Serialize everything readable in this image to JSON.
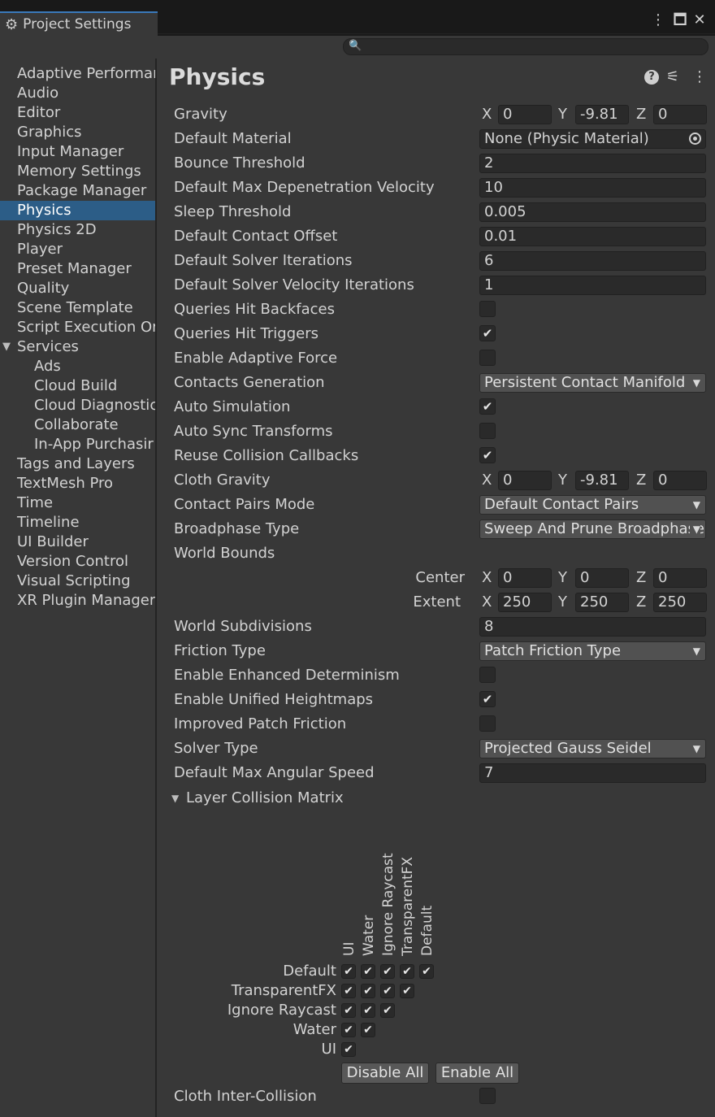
{
  "window": {
    "tab_title": "Project Settings",
    "search_placeholder": ""
  },
  "sidebar": {
    "items": [
      {
        "label": "Adaptive Performar",
        "indent": 0
      },
      {
        "label": "Audio",
        "indent": 0
      },
      {
        "label": "Editor",
        "indent": 0
      },
      {
        "label": "Graphics",
        "indent": 0
      },
      {
        "label": "Input Manager",
        "indent": 0
      },
      {
        "label": "Memory Settings",
        "indent": 0
      },
      {
        "label": "Package Manager",
        "indent": 0
      },
      {
        "label": "Physics",
        "indent": 0,
        "selected": true
      },
      {
        "label": "Physics 2D",
        "indent": 0
      },
      {
        "label": "Player",
        "indent": 0
      },
      {
        "label": "Preset Manager",
        "indent": 0
      },
      {
        "label": "Quality",
        "indent": 0
      },
      {
        "label": "Scene Template",
        "indent": 0
      },
      {
        "label": "Script Execution Or",
        "indent": 0
      },
      {
        "label": "Services",
        "indent": 0,
        "expanded": true
      },
      {
        "label": "Ads",
        "indent": 1
      },
      {
        "label": "Cloud Build",
        "indent": 1
      },
      {
        "label": "Cloud Diagnostic",
        "indent": 1
      },
      {
        "label": "Collaborate",
        "indent": 1
      },
      {
        "label": "In-App Purchasir",
        "indent": 1
      },
      {
        "label": "Tags and Layers",
        "indent": 0
      },
      {
        "label": "TextMesh Pro",
        "indent": 0
      },
      {
        "label": "Time",
        "indent": 0
      },
      {
        "label": "Timeline",
        "indent": 0
      },
      {
        "label": "UI Builder",
        "indent": 0
      },
      {
        "label": "Version Control",
        "indent": 0
      },
      {
        "label": "Visual Scripting",
        "indent": 0
      },
      {
        "label": "XR Plugin Manager",
        "indent": 0
      }
    ]
  },
  "physics": {
    "title": "Physics",
    "gravity": {
      "label": "Gravity",
      "x": "0",
      "y": "-9.81",
      "z": "0"
    },
    "default_material": {
      "label": "Default Material",
      "value": "None (Physic Material)"
    },
    "bounce_threshold": {
      "label": "Bounce Threshold",
      "value": "2"
    },
    "max_depenetration": {
      "label": "Default Max Depenetration Velocity",
      "value": "10"
    },
    "sleep_threshold": {
      "label": "Sleep Threshold",
      "value": "0.005"
    },
    "contact_offset": {
      "label": "Default Contact Offset",
      "value": "0.01"
    },
    "solver_iterations": {
      "label": "Default Solver Iterations",
      "value": "6"
    },
    "solver_velocity_iterations": {
      "label": "Default Solver Velocity Iterations",
      "value": "1"
    },
    "queries_hit_backfaces": {
      "label": "Queries Hit Backfaces",
      "checked": false
    },
    "queries_hit_triggers": {
      "label": "Queries Hit Triggers",
      "checked": true
    },
    "enable_adaptive_force": {
      "label": "Enable Adaptive Force",
      "checked": false
    },
    "contacts_generation": {
      "label": "Contacts Generation",
      "value": "Persistent Contact Manifold"
    },
    "auto_simulation": {
      "label": "Auto Simulation",
      "checked": true
    },
    "auto_sync_transforms": {
      "label": "Auto Sync Transforms",
      "checked": false
    },
    "reuse_collision_callbacks": {
      "label": "Reuse Collision Callbacks",
      "checked": true
    },
    "cloth_gravity": {
      "label": "Cloth Gravity",
      "x": "0",
      "y": "-9.81",
      "z": "0"
    },
    "contact_pairs_mode": {
      "label": "Contact Pairs Mode",
      "value": "Default Contact Pairs"
    },
    "broadphase_type": {
      "label": "Broadphase Type",
      "value": "Sweep And Prune Broadphase"
    },
    "world_bounds": {
      "label": "World Bounds",
      "center": {
        "label": "Center",
        "x": "0",
        "y": "0",
        "z": "0"
      },
      "extent": {
        "label": "Extent",
        "x": "250",
        "y": "250",
        "z": "250"
      }
    },
    "world_subdivisions": {
      "label": "World Subdivisions",
      "value": "8"
    },
    "friction_type": {
      "label": "Friction Type",
      "value": "Patch Friction Type"
    },
    "enhanced_determinism": {
      "label": "Enable Enhanced Determinism",
      "checked": false
    },
    "unified_heightmaps": {
      "label": "Enable Unified Heightmaps",
      "checked": true
    },
    "improved_patch_friction": {
      "label": "Improved Patch Friction",
      "checked": false
    },
    "solver_type": {
      "label": "Solver Type",
      "value": "Projected Gauss Seidel"
    },
    "max_angular_speed": {
      "label": "Default Max Angular Speed",
      "value": "7"
    },
    "layer_matrix": {
      "label": "Layer Collision Matrix",
      "columns": [
        "UI",
        "Water",
        "Ignore Raycast",
        "TransparentFX",
        "Default"
      ],
      "rows": [
        "Default",
        "TransparentFX",
        "Ignore Raycast",
        "Water",
        "UI"
      ],
      "disable_all": "Disable All",
      "enable_all": "Enable All"
    },
    "cloth_inter_collision": {
      "label": "Cloth Inter-Collision",
      "checked": false
    },
    "axis": {
      "x": "X",
      "y": "Y",
      "z": "Z"
    },
    "check_glyph": "✔",
    "caret_glyph": "▼"
  }
}
